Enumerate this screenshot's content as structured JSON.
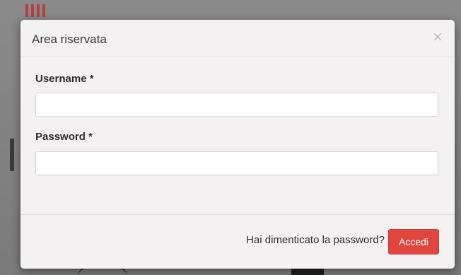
{
  "modal": {
    "title": "Area riservata",
    "close_glyph": "×",
    "username": {
      "label": "Username *",
      "value": "",
      "placeholder": ""
    },
    "password": {
      "label": "Password *",
      "value": "",
      "placeholder": ""
    },
    "footer": {
      "forgot_label": "Hai dimenticato la password?",
      "submit_label": "Accedi"
    }
  },
  "colors": {
    "accent": "#e0463e",
    "modal_bg": "#f3f1f2",
    "overlay": "#7f7f7f"
  },
  "icons": {
    "close": "close-icon"
  }
}
